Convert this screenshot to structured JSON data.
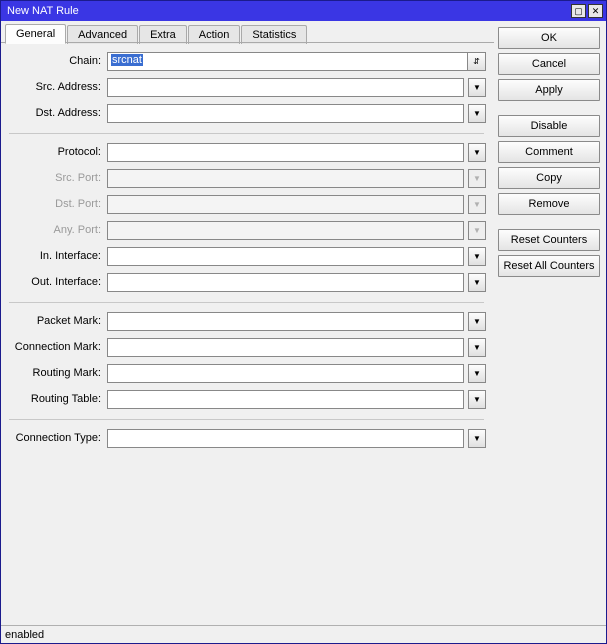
{
  "title": "New NAT Rule",
  "tabs": [
    "General",
    "Advanced",
    "Extra",
    "Action",
    "Statistics"
  ],
  "active_tab": 0,
  "fields": {
    "chain": {
      "label": "Chain:",
      "value": "srcnat",
      "selected": true,
      "arrow": "updown"
    },
    "src_address": {
      "label": "Src. Address:",
      "value": "",
      "arrow": "down"
    },
    "dst_address": {
      "label": "Dst. Address:",
      "value": "",
      "arrow": "down"
    },
    "protocol": {
      "label": "Protocol:",
      "value": "",
      "arrow": "down"
    },
    "src_port": {
      "label": "Src. Port:",
      "value": "",
      "arrow": "down",
      "disabled": true
    },
    "dst_port": {
      "label": "Dst. Port:",
      "value": "",
      "arrow": "down",
      "disabled": true
    },
    "any_port": {
      "label": "Any. Port:",
      "value": "",
      "arrow": "down",
      "disabled": true
    },
    "in_interface": {
      "label": "In. Interface:",
      "value": "",
      "arrow": "down"
    },
    "out_interface": {
      "label": "Out. Interface:",
      "value": "",
      "arrow": "down"
    },
    "packet_mark": {
      "label": "Packet Mark:",
      "value": "",
      "arrow": "down"
    },
    "connection_mark": {
      "label": "Connection Mark:",
      "value": "",
      "arrow": "down"
    },
    "routing_mark": {
      "label": "Routing Mark:",
      "value": "",
      "arrow": "down"
    },
    "routing_table": {
      "label": "Routing Table:",
      "value": "",
      "arrow": "down"
    },
    "connection_type": {
      "label": "Connection Type:",
      "value": "",
      "arrow": "down"
    }
  },
  "buttons": {
    "ok": "OK",
    "cancel": "Cancel",
    "apply": "Apply",
    "disable": "Disable",
    "comment": "Comment",
    "copy": "Copy",
    "remove": "Remove",
    "reset_counters": "Reset Counters",
    "reset_all_counters": "Reset All Counters"
  },
  "status": "enabled",
  "glyphs": {
    "updown": "⇵",
    "down": "▼",
    "minimize": "▢",
    "close": "✕"
  }
}
